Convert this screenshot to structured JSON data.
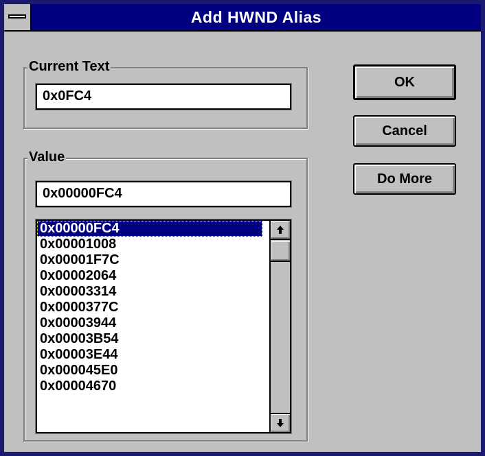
{
  "window": {
    "title": "Add HWND Alias"
  },
  "current_text": {
    "label": "Current Text",
    "value": "0x0FC4"
  },
  "value_group": {
    "label": "Value",
    "input_value": "0x00000FC4",
    "list": {
      "selected_index": 0,
      "items": [
        "0x00000FC4",
        "0x00001008",
        "0x00001F7C",
        "0x00002064",
        "0x00003314",
        "0x0000377C",
        "0x00003944",
        "0x00003B54",
        "0x00003E44",
        "0x000045E0",
        "0x00004670"
      ]
    }
  },
  "buttons": {
    "ok": "OK",
    "cancel": "Cancel",
    "do_more": "Do More"
  },
  "icons": {
    "system_menu": "minus-bar-icon",
    "scroll_up": "up-arrow-icon",
    "scroll_down": "down-arrow-icon"
  },
  "colors": {
    "titlebar": "#000080",
    "dialog_face": "#c0c0c0",
    "selection": "#000080"
  }
}
